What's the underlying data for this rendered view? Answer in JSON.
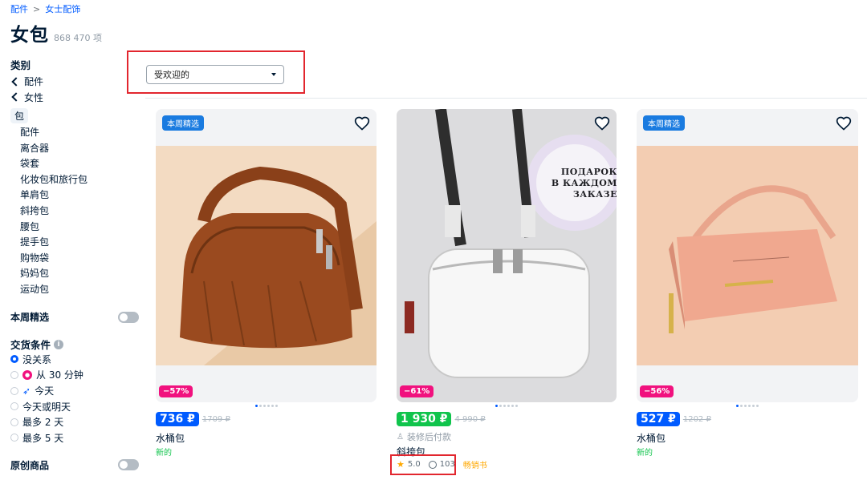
{
  "breadcrumb": {
    "first": "配件",
    "second": "女士配饰"
  },
  "page": {
    "title": "女包",
    "count": "868 470 项"
  },
  "sidebar": {
    "category_heading": "类别",
    "back_links": [
      "配件",
      "女性"
    ],
    "active": "包",
    "subcategories": [
      "配件",
      "离合器",
      "袋套",
      "化妆包和旅行包",
      "单肩包",
      "斜挎包",
      "腰包",
      "提手包",
      "购物袋",
      "妈妈包",
      "运动包"
    ],
    "weekly_picks": "本周精选",
    "delivery_heading": "交货条件",
    "delivery_options": [
      "没关系",
      "从 30 分钟",
      "今天",
      "今天或明天",
      "最多 2 天",
      "最多 5 天"
    ],
    "original_goods": "原创商品"
  },
  "sort": {
    "selected": "受欢迎的"
  },
  "products": [
    {
      "tag": "本周精选",
      "discount": "−57%",
      "price": "736 ₽",
      "old_price": "1709 ₽",
      "name": "水桶包",
      "status": "新的",
      "price_color": "#005bff"
    },
    {
      "tag": "",
      "discount": "−61%",
      "price": "1 930 ₽",
      "old_price": "4 990 ₽",
      "note": "装修后付款",
      "name": "斜挎包",
      "rating": "5.0",
      "reviews": "103",
      "badge": "畅销书",
      "price_color": "#10c44c",
      "promo_text": [
        "ПОДАРОК",
        "В КАЖДОМ",
        "ЗАКАЗЕ"
      ]
    },
    {
      "tag": "本周精选",
      "discount": "−56%",
      "price": "527 ₽",
      "old_price": "1202 ₽",
      "name": "水桶包",
      "status": "新的",
      "price_color": "#005bff"
    }
  ],
  "colors": {
    "accent": "#005bff",
    "discount": "#f1117e",
    "highlight_box": "#e2262e",
    "green": "#10c44c"
  }
}
